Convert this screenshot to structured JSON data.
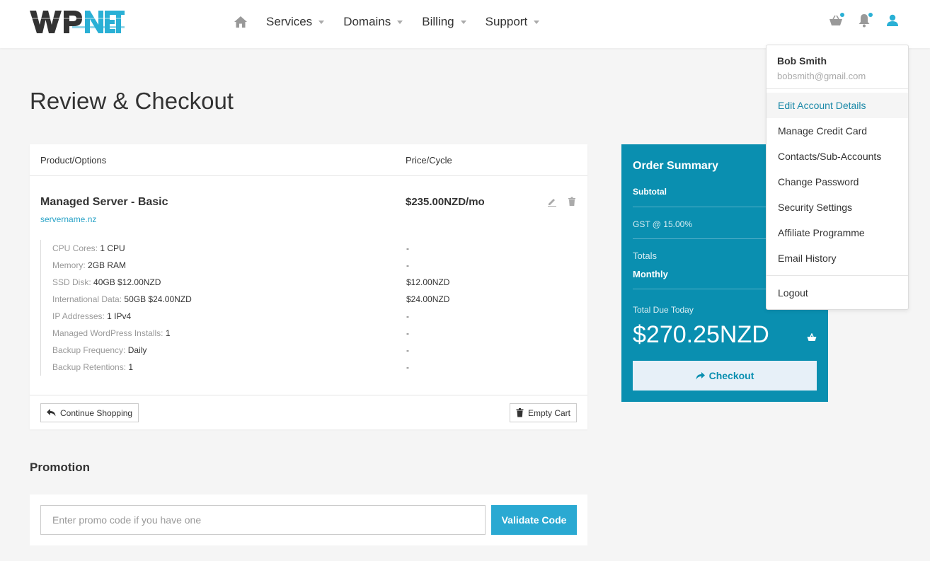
{
  "brand": {
    "logo_text_dark": "WP",
    "logo_text_accent": "NET",
    "accent": "#2ab0d5",
    "summary_bg": "#0a8fb0"
  },
  "nav": {
    "home_icon": "home-icon",
    "items": [
      {
        "label": "Services"
      },
      {
        "label": "Domains"
      },
      {
        "label": "Billing"
      },
      {
        "label": "Support"
      }
    ]
  },
  "header_icons": [
    "basket-icon",
    "bell-icon",
    "user-icon"
  ],
  "page": {
    "title": "Review & Checkout"
  },
  "cart": {
    "col_product": "Product/Options",
    "col_price": "Price/Cycle",
    "product": {
      "name": "Managed Server - Basic",
      "domain": "servername.nz",
      "price": "$235.00NZD/mo"
    },
    "options": [
      {
        "label": "CPU Cores:",
        "value": "1 CPU",
        "price": "-"
      },
      {
        "label": "Memory:",
        "value": "2GB RAM",
        "price": "-"
      },
      {
        "label": "SSD Disk:",
        "value": "40GB $12.00NZD",
        "price": "$12.00NZD"
      },
      {
        "label": "International Data:",
        "value": "50GB $24.00NZD",
        "price": "$24.00NZD"
      },
      {
        "label": "IP Addresses:",
        "value": "1 IPv4",
        "price": "-"
      },
      {
        "label": "Managed WordPress Installs:",
        "value": "1",
        "price": "-"
      },
      {
        "label": "Backup Frequency:",
        "value": "Daily",
        "price": "-"
      },
      {
        "label": "Backup Retentions:",
        "value": "1",
        "price": "-"
      }
    ],
    "continue_label": "Continue Shopping",
    "empty_label": "Empty Cart"
  },
  "promotion": {
    "title": "Promotion",
    "placeholder": "Enter promo code if you have one",
    "button": "Validate Code"
  },
  "summary": {
    "title": "Order Summary",
    "subtotal_label": "Subtotal",
    "gst_label": "GST @ 15.00%",
    "totals_label": "Totals",
    "monthly_label": "Monthly",
    "due_label": "Total Due Today",
    "total": "$270.25NZD",
    "checkout_label": "Checkout"
  },
  "account_menu": {
    "name": "Bob Smith",
    "email": "bobsmith@gmail.com",
    "items": [
      {
        "label": "Edit Account Details"
      },
      {
        "label": "Manage Credit Card"
      },
      {
        "label": "Contacts/Sub-Accounts"
      },
      {
        "label": "Change Password"
      },
      {
        "label": "Security Settings"
      },
      {
        "label": "Affiliate Programme"
      },
      {
        "label": "Email History"
      }
    ],
    "logout": "Logout"
  }
}
